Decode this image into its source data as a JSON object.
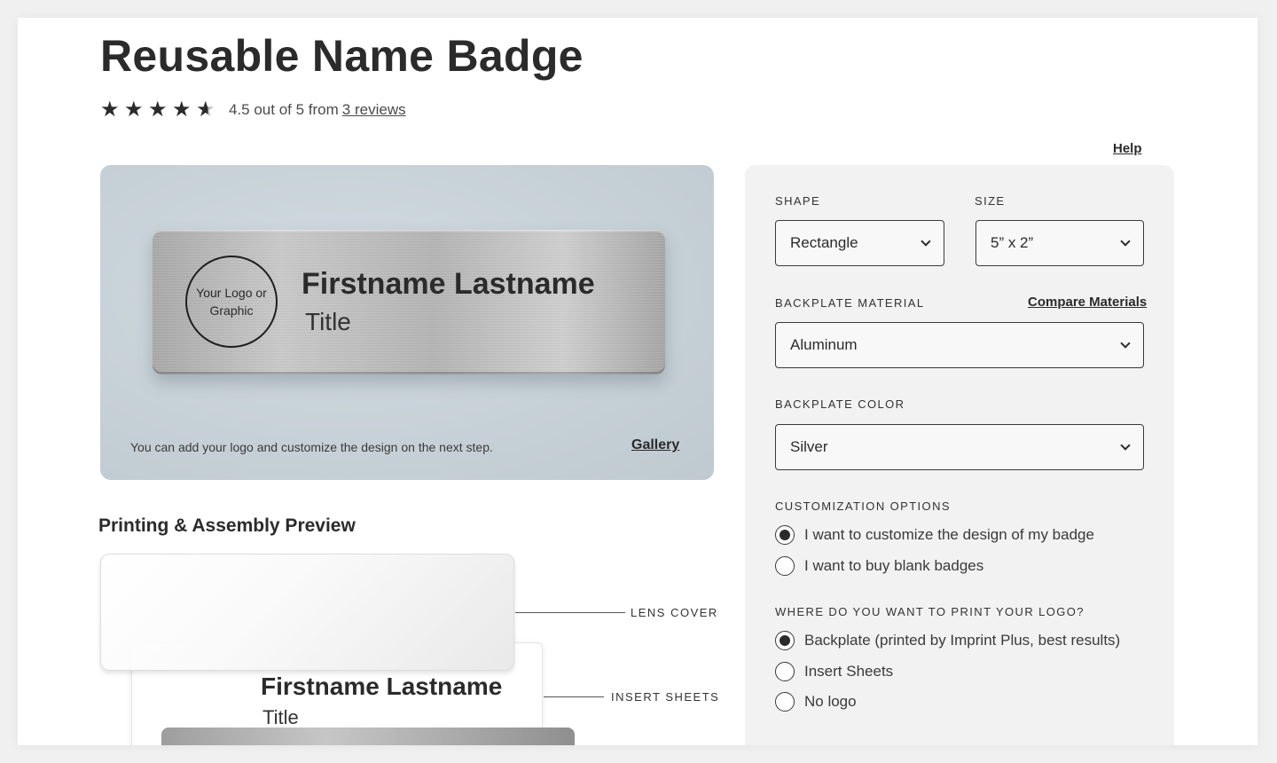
{
  "product": {
    "title": "Reusable Name Badge",
    "rating_text": "4.5 out of 5 from",
    "reviews_link": "3 reviews",
    "rating_value": 4.5
  },
  "help_link": "Help",
  "preview": {
    "logo_text": "Your Logo or Graphic",
    "badge_name": "Firstname Lastname",
    "badge_title": "Title",
    "note": "You can add your logo and customize the design on the next step.",
    "gallery_link": "Gallery"
  },
  "assembly": {
    "heading": "Printing & Assembly Preview",
    "lens_cover_label": "LENS COVER",
    "insert_sheets_label": "INSERT SHEETS",
    "insert_name": "Firstname Lastname",
    "insert_title": "Title"
  },
  "options": {
    "shape": {
      "label": "SHAPE",
      "value": "Rectangle"
    },
    "size": {
      "label": "SIZE",
      "value": "5” x 2”"
    },
    "backplate_material": {
      "label": "BACKPLATE MATERIAL",
      "value": "Aluminum",
      "compare_link": "Compare Materials"
    },
    "backplate_color": {
      "label": "BACKPLATE COLOR",
      "value": "Silver"
    },
    "customization": {
      "label": "CUSTOMIZATION OPTIONS",
      "choices": [
        {
          "label": "I want to customize the design of my badge",
          "checked": true
        },
        {
          "label": "I want to buy blank badges",
          "checked": false
        }
      ]
    },
    "logo_location": {
      "label": "WHERE DO YOU WANT TO PRINT YOUR LOGO?",
      "choices": [
        {
          "label": "Backplate (printed by Imprint Plus, best results)",
          "checked": true
        },
        {
          "label": "Insert Sheets",
          "checked": false
        },
        {
          "label": "No logo",
          "checked": false
        }
      ]
    }
  },
  "colors": {
    "text": "#2b2b2b",
    "panel_bg": "#f2f2f2",
    "preview_bg": "#c4cfd5"
  },
  "icons": {
    "star": "★",
    "chevron": "chevron-down-icon"
  }
}
